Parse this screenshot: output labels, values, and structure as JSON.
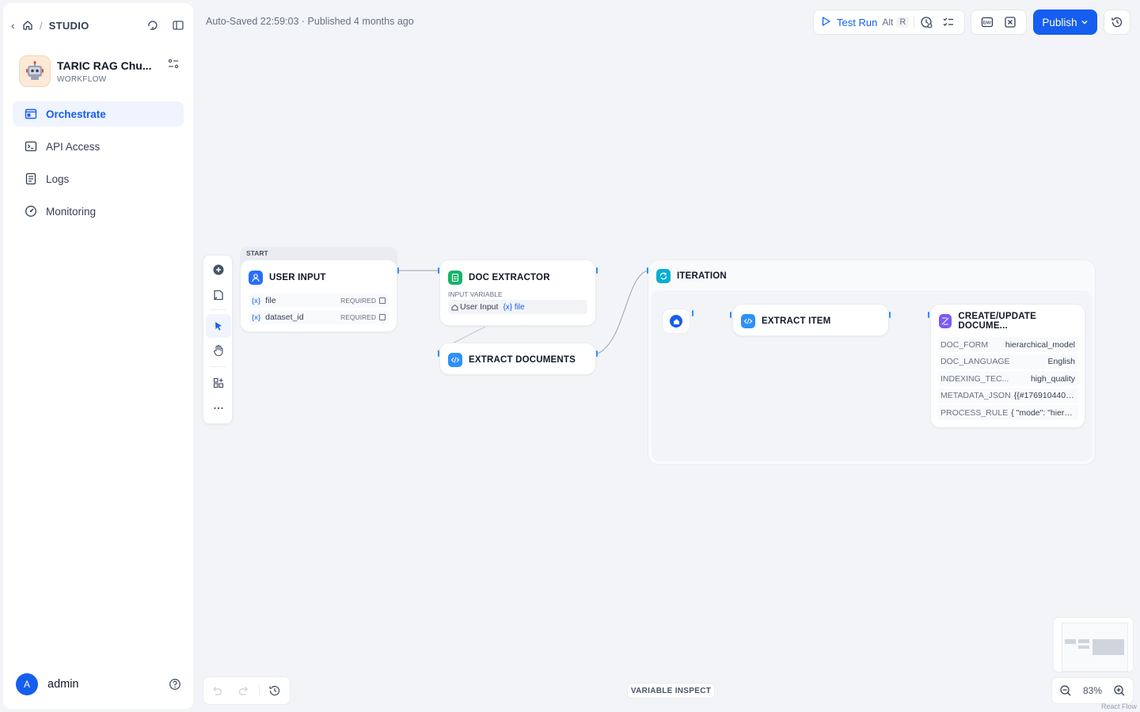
{
  "sidebar": {
    "studio_label": "STUDIO",
    "app_name": "TARIC RAG Chu...",
    "app_type": "WORKFLOW",
    "nav": [
      {
        "label": "Orchestrate",
        "icon": "orchestrate-icon",
        "active": true
      },
      {
        "label": "API Access",
        "icon": "terminal-icon"
      },
      {
        "label": "Logs",
        "icon": "logs-icon"
      },
      {
        "label": "Monitoring",
        "icon": "monitoring-icon"
      }
    ],
    "user_initial": "A",
    "user_name": "admin"
  },
  "header": {
    "autosave": "Auto-Saved 22:59:03 · Published 4 months ago",
    "test_run_label": "Test Run",
    "test_run_shortcut_mod": "Alt",
    "test_run_shortcut_key": "R",
    "publish_label": "Publish"
  },
  "nodes": {
    "start": {
      "tag": "START",
      "title": "USER INPUT",
      "vars": [
        {
          "prefix": "{x}",
          "name": "file",
          "required": "REQUIRED"
        },
        {
          "prefix": "{x}",
          "name": "dataset_id",
          "required": "REQUIRED"
        }
      ]
    },
    "doc_extractor": {
      "title": "DOC EXTRACTOR",
      "input_label": "INPUT VARIABLE",
      "input_source": "User Input",
      "input_var": "{x} file"
    },
    "extract_documents": {
      "title": "EXTRACT DOCUMENTS"
    },
    "iteration": {
      "title": "ITERATION"
    },
    "extract_item": {
      "title": "EXTRACT ITEM"
    },
    "create_update": {
      "title": "CREATE/UPDATE DOCUME...",
      "props": [
        {
          "key": "DOC_FORM",
          "value": "hierarchical_model"
        },
        {
          "key": "DOC_LANGUAGE",
          "value": "English"
        },
        {
          "key": "INDEXING_TEC...",
          "value": "high_quality"
        },
        {
          "key": "METADATA_JSON",
          "value": "{{#17691044000..."
        },
        {
          "key": "PROCESS_RULE",
          "value": "{ \"mode\": \"hierarc..."
        }
      ]
    }
  },
  "bottom": {
    "variable_inspect": "VARIABLE INSPECT",
    "zoom": "83%",
    "attribution": "React Flow"
  },
  "colors": {
    "accent": "#155eef",
    "start_icon": "#296dff",
    "doc_extractor_icon": "#17b26a",
    "code_icon": "#2e90fa",
    "iteration_icon": "#06aed4",
    "knowledge_icon": "#7a5af8"
  }
}
